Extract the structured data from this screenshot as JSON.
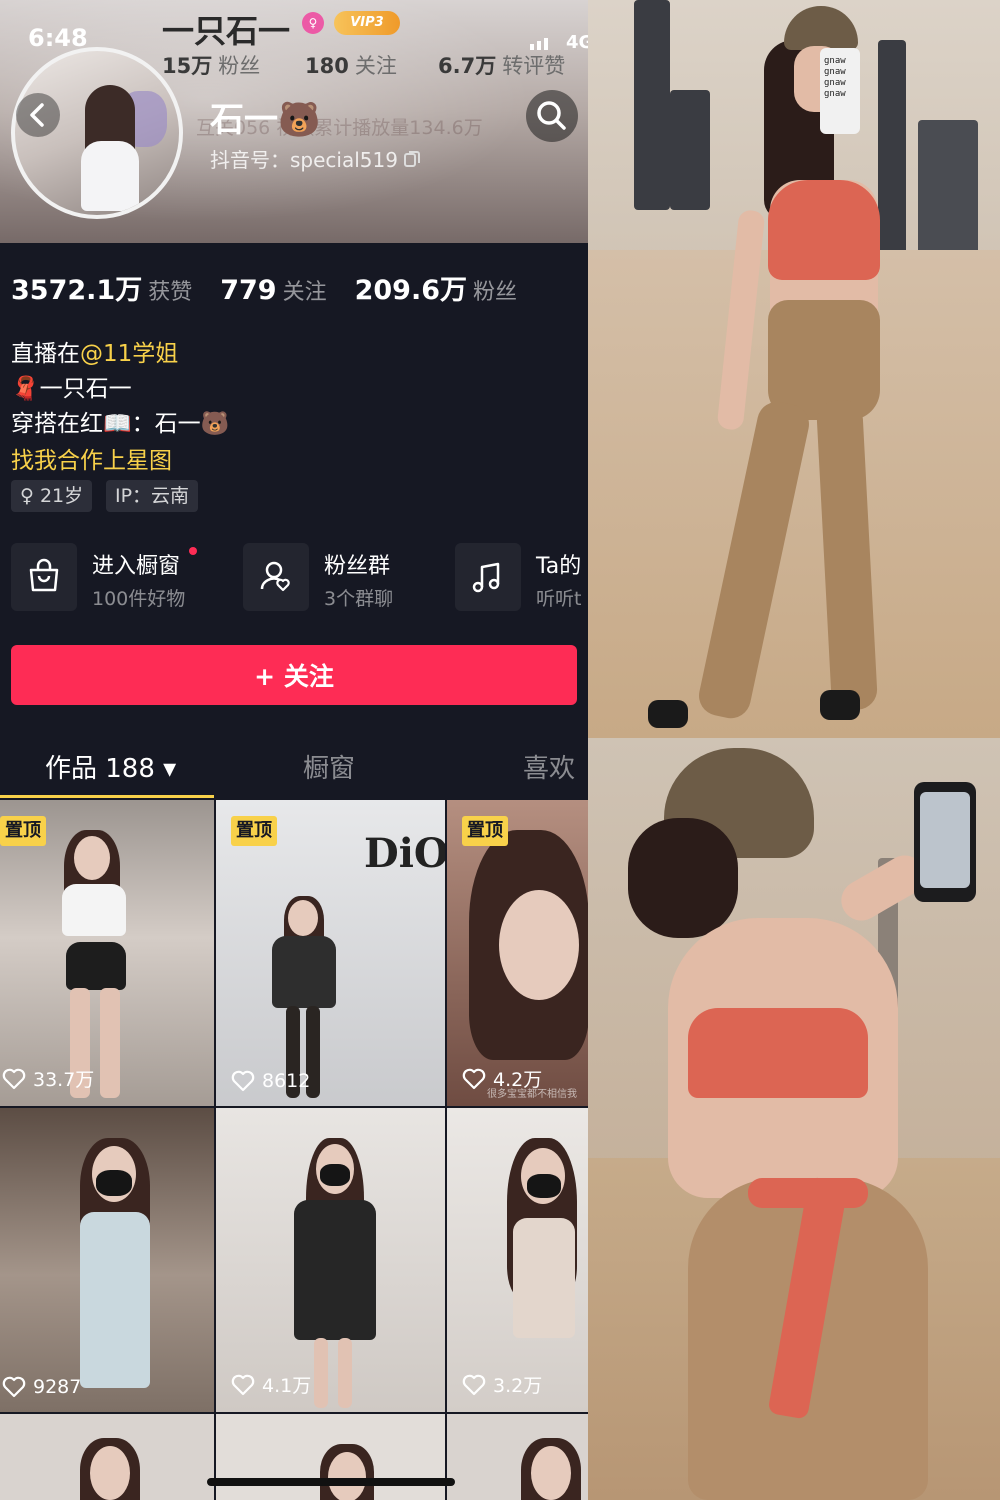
{
  "status_bar": {
    "time": "6:48",
    "network": "4G"
  },
  "ghost_header": {
    "name": "一只石一",
    "vip": "VIP3",
    "stats": [
      {
        "value": "15万",
        "label": "粉丝"
      },
      {
        "value": "180",
        "label": "关注"
      },
      {
        "value": "6.7万",
        "label": "转评赞"
      }
    ],
    "line": "互关056   视频累计播放量134.6万"
  },
  "profile": {
    "name": "石一🐻",
    "douyin_id": "抖音号：special519"
  },
  "stats": [
    {
      "value": "3572.1万",
      "label": "获赞"
    },
    {
      "value": "779",
      "label": "关注"
    },
    {
      "value": "209.6万",
      "label": "粉丝"
    }
  ],
  "bio": {
    "line1_prefix": "直播在",
    "line1_mention": "@11学姐",
    "line2": "🧣一只石一",
    "line3": "穿搭在红📖：石一🐻",
    "line4": "找我合作上星图"
  },
  "tags": [
    "♀ 21岁",
    "IP：云南"
  ],
  "features": [
    {
      "title": "进入橱窗",
      "subtitle": "100件好物",
      "icon": "shopping-bag-icon"
    },
    {
      "title": "粉丝群",
      "subtitle": "3个群聊",
      "icon": "group-chat-icon"
    },
    {
      "title": "Ta的",
      "subtitle": "听听t",
      "icon": "music-note-icon"
    }
  ],
  "follow_button": {
    "label": "+ 关注"
  },
  "tabs": [
    {
      "label": "作品 188 ▾"
    },
    {
      "label": "橱窗"
    },
    {
      "label": "喜欢"
    }
  ],
  "videos": [
    {
      "pinned": "置顶",
      "likes": "33.7万"
    },
    {
      "pinned": "置顶",
      "likes": "8612",
      "overlay": "DiO"
    },
    {
      "pinned": "置顶",
      "likes": "4.2万",
      "caption": "很多宝宝都不相信我"
    },
    {
      "likes": "9287"
    },
    {
      "likes": "4.1万"
    },
    {
      "likes": "3.2万"
    }
  ],
  "photo_overlay_text": [
    "gnaw",
    "gnaw",
    "gnaw",
    "gnaw"
  ],
  "colors": {
    "accent": "#fe2c55",
    "highlight": "#f8d14a",
    "background": "#161823"
  }
}
